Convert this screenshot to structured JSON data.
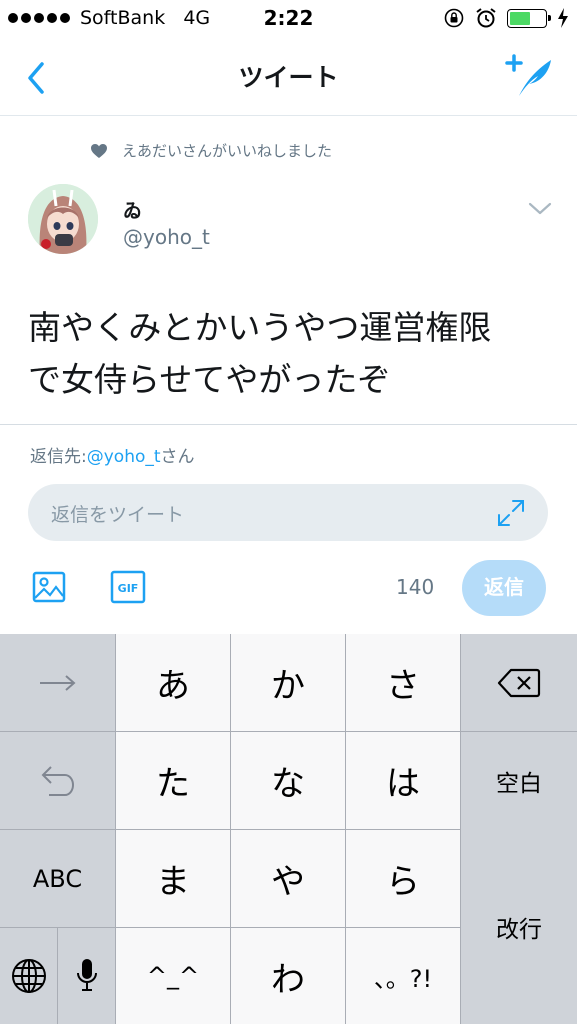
{
  "status_bar": {
    "carrier": "SoftBank",
    "network": "4G",
    "time": "2:22",
    "battery_level": 0.6,
    "icons": [
      "signal-dots",
      "rotation-lock-icon",
      "alarm-icon",
      "battery-icon",
      "charging-bolt-icon"
    ]
  },
  "nav": {
    "title": "ツイート",
    "back_icon": "chevron-left-icon",
    "compose_icon": "compose-feather-icon"
  },
  "tweet": {
    "social_context": "えあだいさんがいいねしました",
    "display_name": "ゐ",
    "handle": "@yoho_t",
    "text_line1": "南やくみとかいうやつ運営権限",
    "text_line2": "で女侍らせてやがったぞ"
  },
  "reply": {
    "prefix": "返信先:",
    "user": "@yoho_t",
    "suffix": "さん",
    "placeholder": "返信をツイート",
    "char_count": "140",
    "button_label": "返信"
  },
  "keyboard": {
    "row1": [
      "あ",
      "か",
      "さ"
    ],
    "row2": [
      "た",
      "な",
      "は"
    ],
    "row3": [
      "ま",
      "や",
      "ら"
    ],
    "row4": [
      "^_^",
      "わ",
      "、。?!"
    ],
    "abc": "ABC",
    "space": "空白",
    "enter": "改行"
  },
  "colors": {
    "accent": "#1da1f2",
    "muted": "#657786",
    "reply_button": "#b5dcf9",
    "input_bg": "#e6ecf0",
    "keyboard_bg": "#cfd3d9",
    "key_bg": "#f8f8f9"
  }
}
